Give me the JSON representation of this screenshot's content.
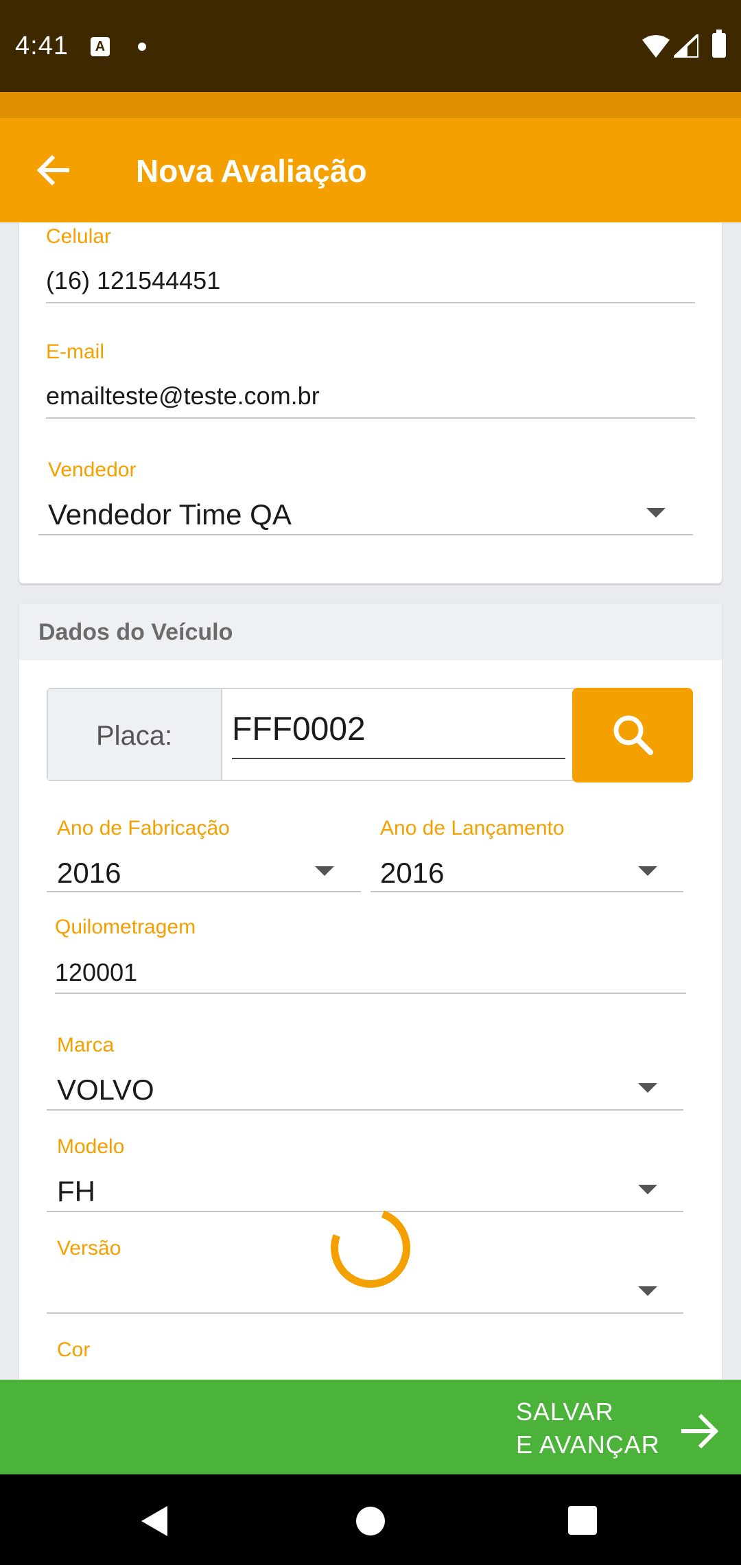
{
  "status_bar": {
    "time": "4:41",
    "notification_icon": "A"
  },
  "app_bar": {
    "title": "Nova Avaliação"
  },
  "contact": {
    "celular_label": "Celular",
    "celular_value": "(16) 121544451",
    "email_label": "E-mail",
    "email_value": "emailteste@teste.com.br",
    "vendedor_label": "Vendedor",
    "vendedor_value": "Vendedor Time QA"
  },
  "vehicle": {
    "section_title": "Dados do Veículo",
    "placa_label": "Placa:",
    "placa_value": "FFF0002",
    "ano_fabricacao_label": "Ano de Fabricação",
    "ano_fabricacao_value": "2016",
    "ano_lancamento_label": "Ano de Lançamento",
    "ano_lancamento_value": "2016",
    "quilometragem_label": "Quilometragem",
    "quilometragem_value": "120001",
    "marca_label": "Marca",
    "marca_value": "VOLVO",
    "modelo_label": "Modelo",
    "modelo_value": "FH",
    "versao_label": "Versão",
    "versao_value": "",
    "cor_label": "Cor"
  },
  "save_button": {
    "line1": "SALVAR",
    "line2": "E AVANÇAR"
  },
  "colors": {
    "accent": "#f4a000",
    "status_bar": "#3d2800",
    "save": "#4bb33a"
  }
}
